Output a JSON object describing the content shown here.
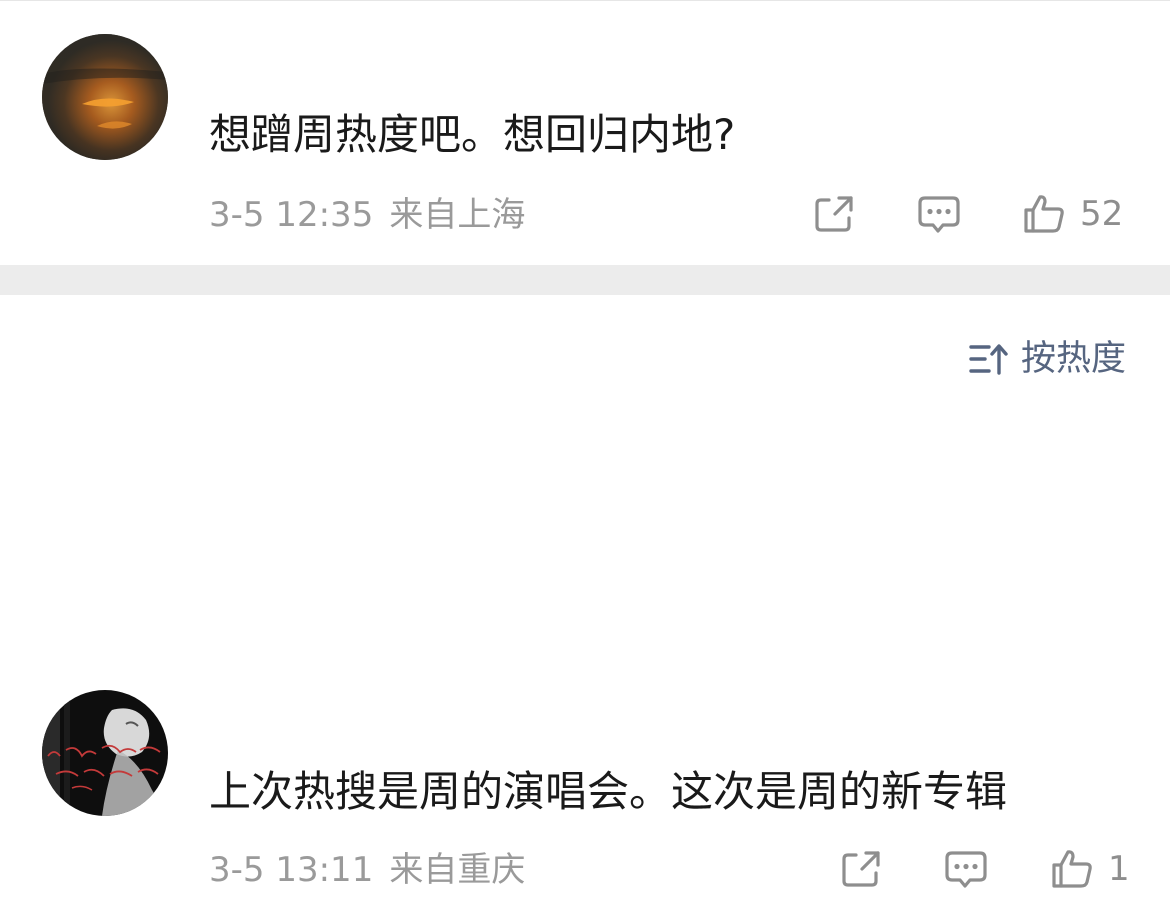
{
  "comments": [
    {
      "text": "想蹭周热度吧。想回归内地?",
      "time": "3-5 12:35",
      "location": "来自上海",
      "like_count": "52",
      "icons": [
        "share-icon",
        "comment-icon",
        "thumbs-up-icon"
      ]
    },
    {
      "text": "上次热搜是周的演唱会。这次是周的新专辑",
      "time": "3-5 13:11",
      "location": "来自重庆",
      "like_count": "1",
      "icons": [
        "share-icon",
        "comment-icon",
        "thumbs-up-icon"
      ]
    }
  ],
  "sort": {
    "label": "按热度",
    "icon": "sort-icon"
  },
  "colors": {
    "meta_text": "#9a9a9a",
    "sort_accent": "#566580",
    "separator": "#ececec"
  }
}
